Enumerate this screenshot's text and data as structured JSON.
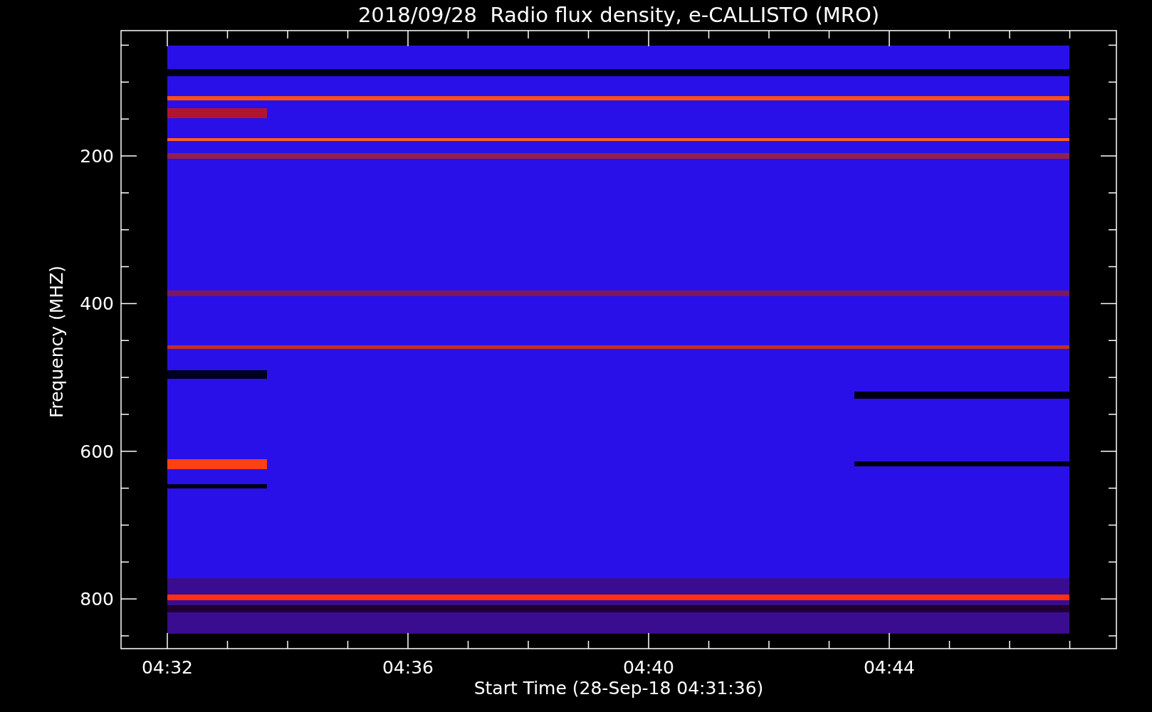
{
  "title": "2018/09/28  Radio flux density, e-CALLISTO (MRO)",
  "y_axis": {
    "label": "Frequency (MHZ)",
    "ticks": [
      "200",
      "400",
      "600",
      "800"
    ]
  },
  "x_axis": {
    "label": "Start Time (28-Sep-18 04:31:36)",
    "ticks": [
      "04:32",
      "04:36",
      "04:40",
      "04:44"
    ]
  }
}
